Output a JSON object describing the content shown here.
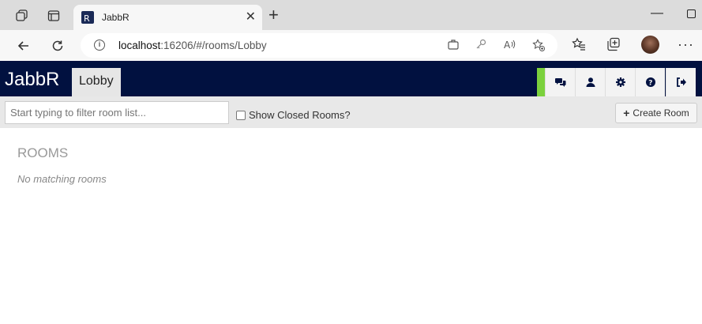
{
  "browser": {
    "tab_title": "JabbR",
    "tab_close": "✕",
    "new_tab": "+",
    "url_host": "localhost",
    "url_rest": ":16206/#/rooms/Lobby",
    "minimize": "—"
  },
  "app": {
    "brand": "JabbR",
    "room_tab": "Lobby",
    "accent_color": "#7bd13d",
    "header_color": "#011140",
    "header_buttons": [
      "chat-icon",
      "user-icon",
      "gear-icon",
      "help-icon",
      "sign-out-icon"
    ]
  },
  "toolbar": {
    "filter_placeholder": "Start typing to filter room list...",
    "show_closed_label": "Show Closed Rooms?",
    "create_room_label": "Create Room",
    "create_room_icon": "+"
  },
  "content": {
    "rooms_heading": "ROOMS",
    "empty_message": "No matching rooms"
  }
}
